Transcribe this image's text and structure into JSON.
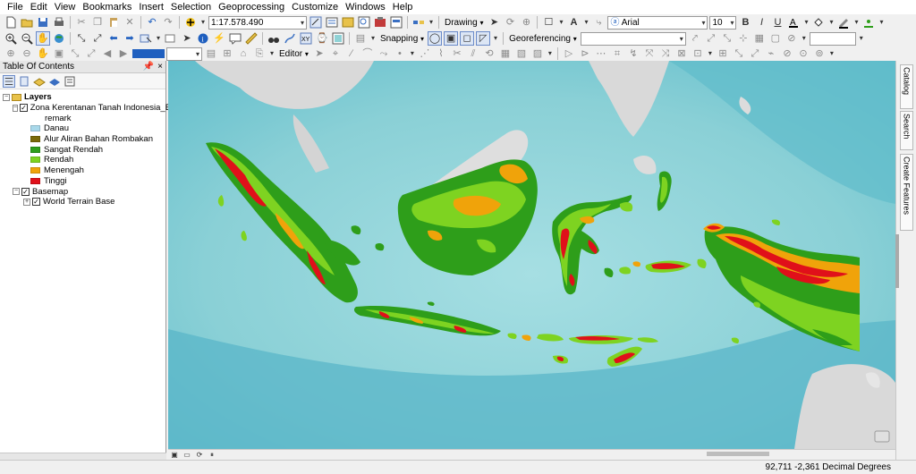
{
  "menu": [
    "File",
    "Edit",
    "View",
    "Bookmarks",
    "Insert",
    "Selection",
    "Geoprocessing",
    "Customize",
    "Windows",
    "Help"
  ],
  "toolbar": {
    "scale": "1:17.578.490",
    "drawing_label": "Drawing",
    "font_name": "Arial",
    "font_size": "10",
    "bold": "B",
    "italic": "I",
    "underline": "U",
    "snapping_label": "Snapping",
    "georeferencing_label": "Georeferencing",
    "editor_label": "Editor"
  },
  "toc": {
    "title": "Table Of Contents",
    "pin": "█",
    "close": "×",
    "layers_label": "Layers",
    "layer1": "Zona Kerentanan Tanah Indonesia_ESDM",
    "field": "remark",
    "legend": [
      {
        "label": "Danau",
        "color": "#a8d8ea"
      },
      {
        "label": "Alur Aliran Bahan Rombakan",
        "color": "#7a6a08"
      },
      {
        "label": "Sangat Rendah",
        "color": "#2e9e1a"
      },
      {
        "label": "Rendah",
        "color": "#7ed321"
      },
      {
        "label": "Menengah",
        "color": "#f0a30a"
      },
      {
        "label": "Tinggi",
        "color": "#e0101a"
      }
    ],
    "basemap_label": "Basemap",
    "basemap_layer": "World Terrain Base"
  },
  "dock": {
    "catalog": "Catalog",
    "search": "Search",
    "create_features": "Create Features"
  },
  "status": {
    "coords": "92,711  -2,361 Decimal Degrees"
  },
  "colors": {
    "ocean_deep": "#6cc3cf",
    "ocean_shallow": "#a9e1e6",
    "land_grey": "#d9d9d9",
    "accent_blue": "#1f5fbf"
  }
}
